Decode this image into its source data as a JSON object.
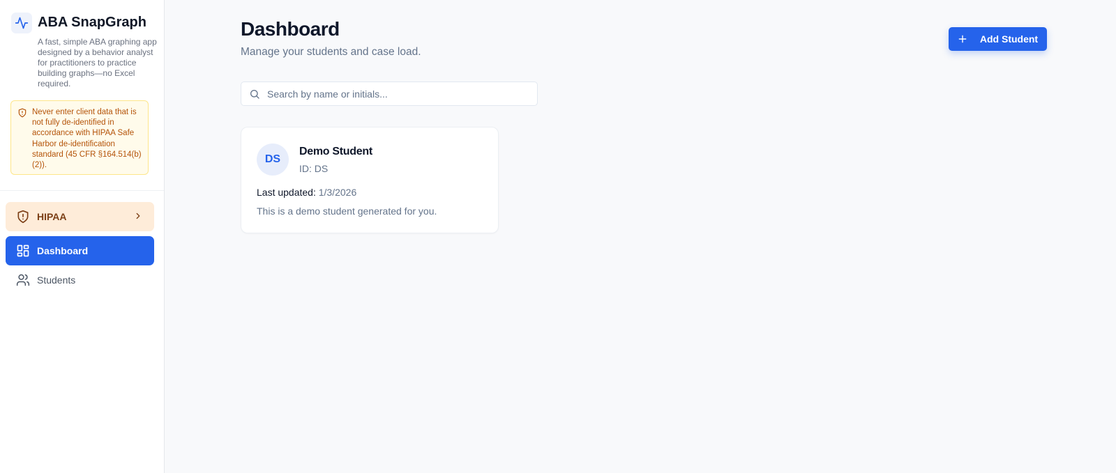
{
  "app": {
    "title": "ABA SnapGraph",
    "description": "A fast, simple ABA graphing app designed by a behavior analyst for practitioners to practice building graphs—no Excel required.",
    "icon": "activity-icon"
  },
  "warning": {
    "text": "Never enter client data that is not fully de-identified in accordance with HIPAA Safe Harbor de-identification standard (45 CFR §164.514(b)(2)).",
    "icon": "shield-alert-icon"
  },
  "nav": {
    "hipaa": {
      "label": "HIPAA",
      "icon": "shield-alert-icon"
    },
    "dashboard": {
      "label": "Dashboard",
      "icon": "layout-dashboard-icon"
    },
    "students": {
      "label": "Students",
      "icon": "users-icon"
    }
  },
  "header": {
    "title": "Dashboard",
    "subtitle": "Manage your students and case load.",
    "add_button_label": "Add Student"
  },
  "search": {
    "placeholder": "Search by name or initials...",
    "value": ""
  },
  "students": [
    {
      "initials": "DS",
      "name": "Demo Student",
      "id_text": "ID: DS",
      "last_updated_label": "Last updated:",
      "last_updated_value": "1/3/2026",
      "description": "This is a demo student generated for you."
    }
  ],
  "colors": {
    "accent": "#2563eb",
    "warning_bg": "#fffbeb",
    "warning_text": "#b45309",
    "hipaa_bg": "#feecd9"
  }
}
